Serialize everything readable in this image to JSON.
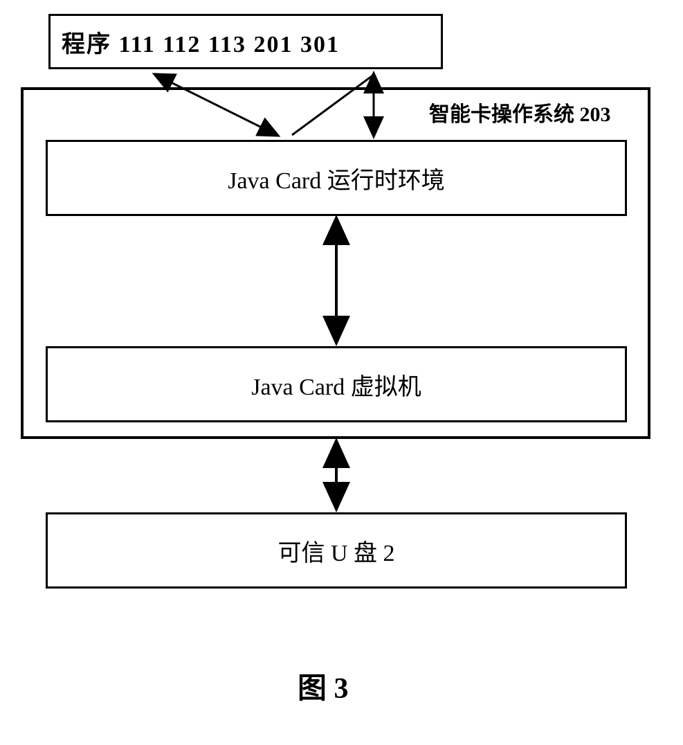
{
  "top_box": "程序 111  112  113  201  301",
  "os_label": "智能卡操作系统 203",
  "runtime": "Java Card 运行时环境",
  "vm": "Java Card 虚拟机",
  "usb": "可信 U 盘 2",
  "caption": "图 3"
}
